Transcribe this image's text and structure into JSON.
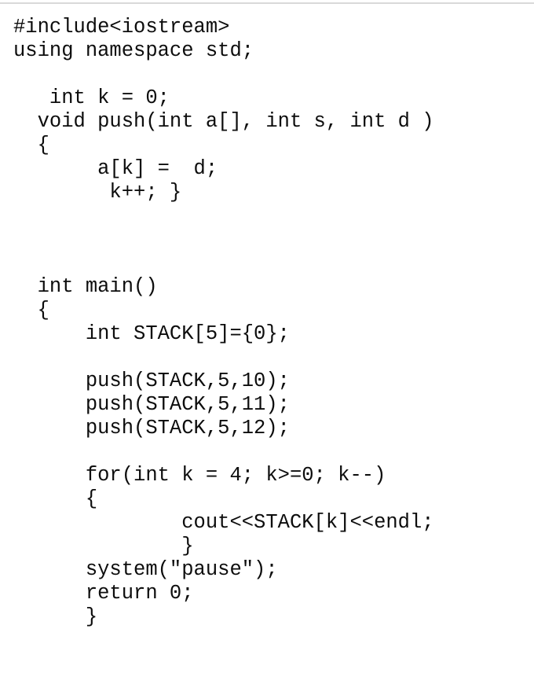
{
  "document": {
    "kind": "code-listing",
    "language": "C++",
    "background_color": "#ffffff",
    "text_color": "#0d0d0d",
    "rule_color": "#d9d9d9"
  },
  "code": {
    "lines": [
      {
        "text": "#include<iostream>"
      },
      {
        "text": "using namespace std;"
      },
      {
        "text": ""
      },
      {
        "text": "   int k = 0;"
      },
      {
        "text": "  void push(int a[], int s, int d )"
      },
      {
        "text": "  {"
      },
      {
        "text": "       a[k] =  d;"
      },
      {
        "text": "        k++; }"
      },
      {
        "text": ""
      },
      {
        "text": ""
      },
      {
        "text": ""
      },
      {
        "text": "  int main()"
      },
      {
        "text": "  {"
      },
      {
        "text": "      int STACK[5]={0};"
      },
      {
        "text": ""
      },
      {
        "text": "      push(STACK,5,10);"
      },
      {
        "text": "      push(STACK,5,11);"
      },
      {
        "text": "      push(STACK,5,12);"
      },
      {
        "text": ""
      },
      {
        "text": "      for(int k = 4; k>=0; k--)"
      },
      {
        "text": "      {"
      },
      {
        "text": "              cout<<STACK[k]<<endl;"
      },
      {
        "text": "              }"
      },
      {
        "text": "      system(\"pause\");"
      },
      {
        "text": "      return 0;"
      },
      {
        "text": "      }"
      }
    ]
  }
}
